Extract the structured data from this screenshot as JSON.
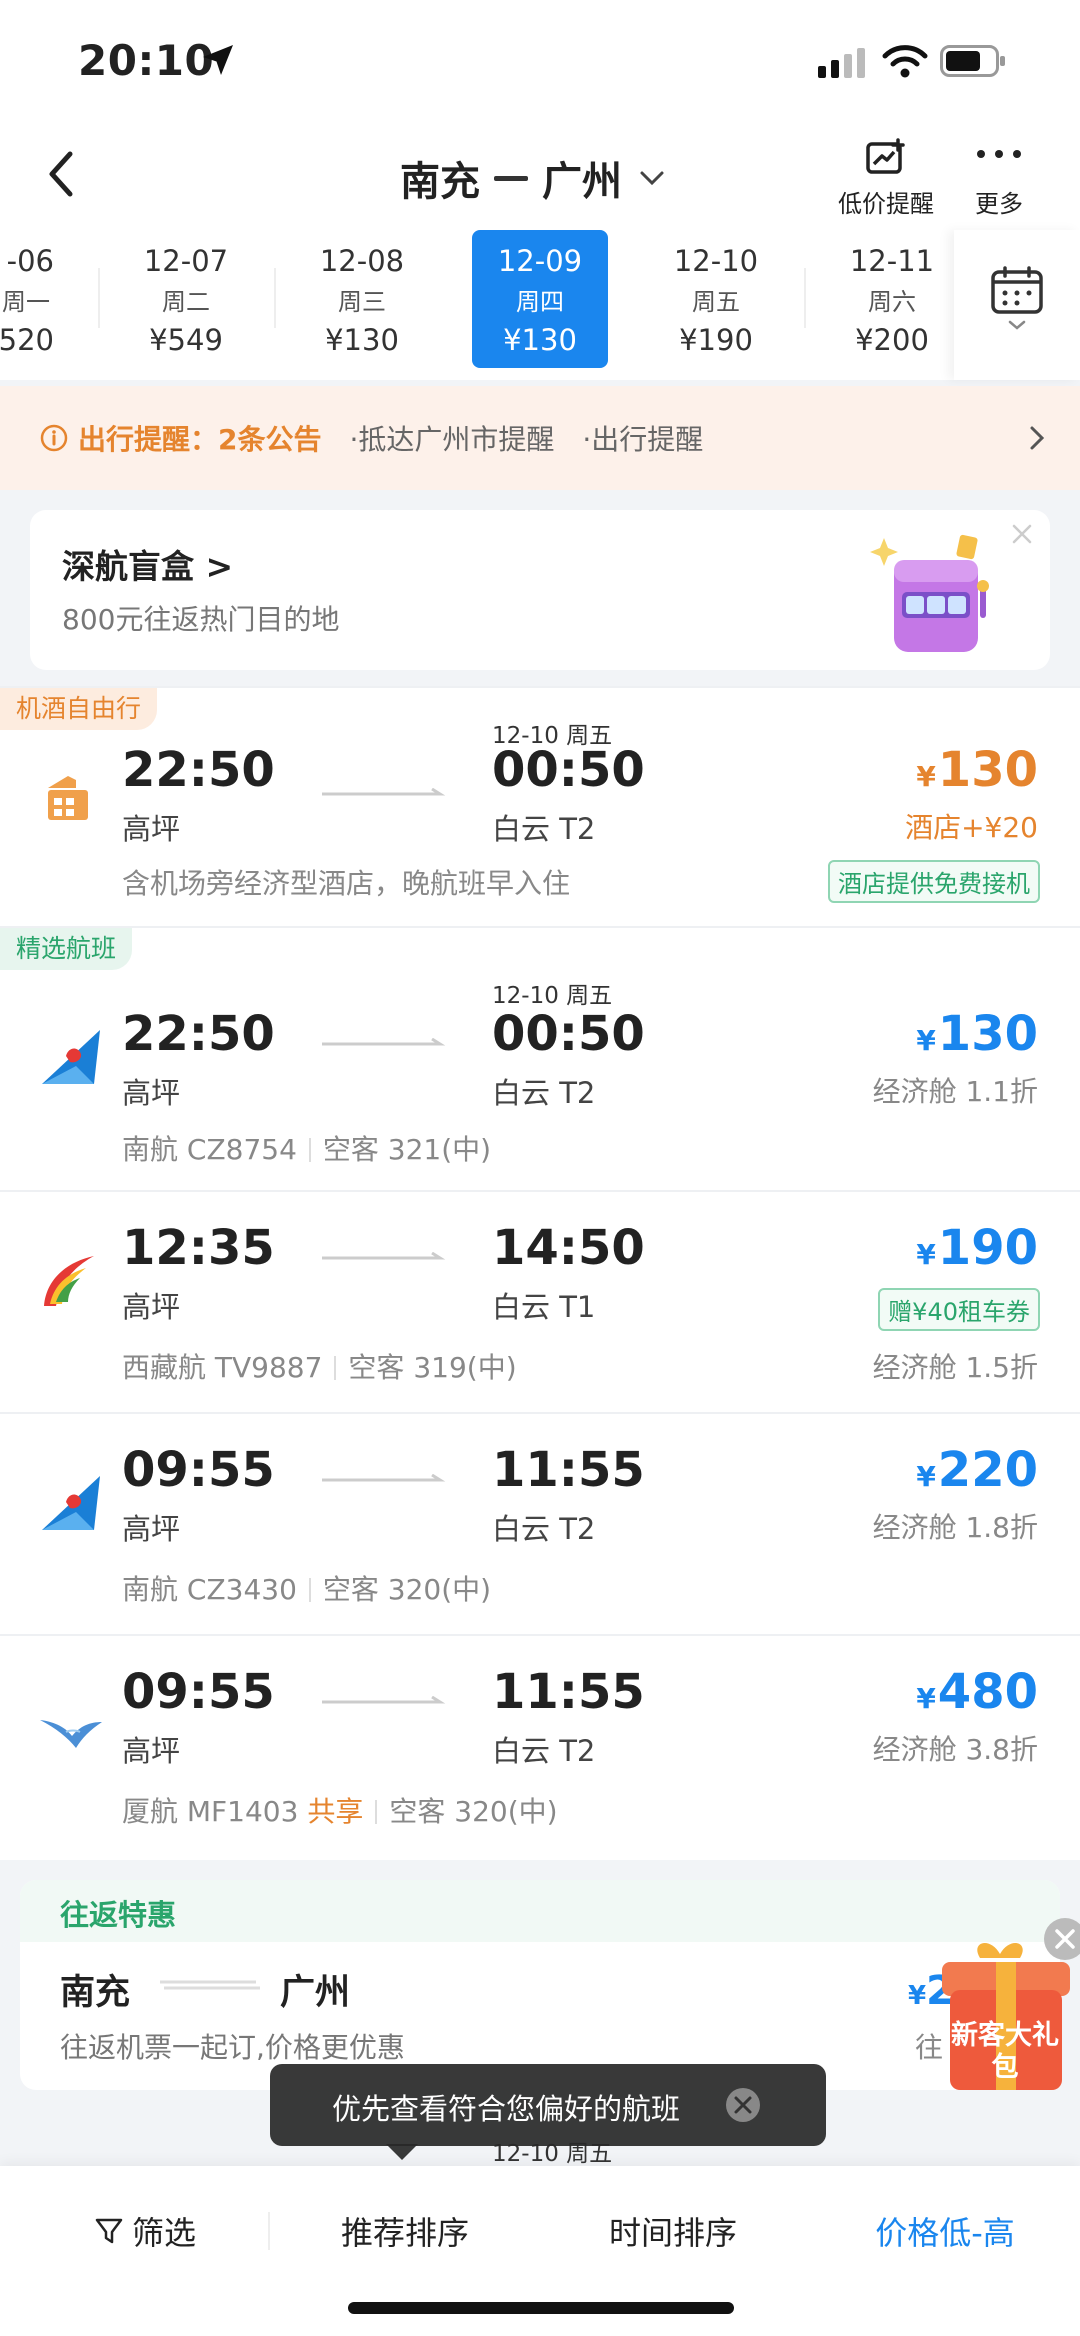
{
  "status_bar": {
    "time": "20:10"
  },
  "header": {
    "origin": "南充",
    "destination": "广州",
    "price_alert_label": "低价提醒",
    "more_label": "更多"
  },
  "dates": [
    {
      "date": "-06",
      "weekday": "周一",
      "price": "520",
      "active": false
    },
    {
      "date": "12-07",
      "weekday": "周二",
      "price": "¥549",
      "active": false
    },
    {
      "date": "12-08",
      "weekday": "周三",
      "price": "¥130",
      "active": false
    },
    {
      "date": "12-09",
      "weekday": "周四",
      "price": "¥130",
      "active": true
    },
    {
      "date": "12-10",
      "weekday": "周五",
      "price": "¥190",
      "active": false
    },
    {
      "date": "12-11",
      "weekday": "周六",
      "price": "¥200",
      "active": false
    }
  ],
  "notice": {
    "label": "出行提醒：",
    "count": "2条公告",
    "items": [
      "·抵达广州市提醒",
      "·出行提醒"
    ]
  },
  "promo": {
    "title": "深航盲盒 >",
    "subtitle": "800元往返热门目的地"
  },
  "flights": [
    {
      "tag": "机酒自由行",
      "dep_time": "22:50",
      "dep_airport": "高坪",
      "arr_date": "12-10 周五",
      "arr_time": "00:50",
      "arr_airport": "白云 T2",
      "price": "130",
      "sub": "酒店+¥20",
      "meta": "含机场旁经济型酒店，晚航班早入住",
      "badge": "酒店提供免费接机"
    },
    {
      "tag": "精选航班",
      "dep_time": "22:50",
      "dep_airport": "高坪",
      "arr_date": "12-10 周五",
      "arr_time": "00:50",
      "arr_airport": "白云 T2",
      "price": "130",
      "sub": "经济舱 1.1折",
      "airline": "南航 CZ8754",
      "aircraft": "空客 321(中)"
    },
    {
      "dep_time": "12:35",
      "dep_airport": "高坪",
      "arr_time": "14:50",
      "arr_airport": "白云 T1",
      "price": "190",
      "badge": "赠¥40租车券",
      "sub": "经济舱 1.5折",
      "airline": "西藏航 TV9887",
      "aircraft": "空客 319(中)"
    },
    {
      "dep_time": "09:55",
      "dep_airport": "高坪",
      "arr_time": "11:55",
      "arr_airport": "白云 T2",
      "price": "220",
      "sub": "经济舱 1.8折",
      "airline": "南航 CZ3430",
      "aircraft": "空客 320(中)"
    },
    {
      "dep_time": "09:55",
      "dep_airport": "高坪",
      "arr_time": "11:55",
      "arr_airport": "白云 T2",
      "price": "480",
      "sub": "经济舱 3.8折",
      "airline": "厦航 MF1403",
      "share": "共享",
      "aircraft": "空客 320(中)"
    }
  ],
  "round_trip": {
    "label": "往返特惠",
    "from": "南充",
    "to": "广州",
    "subtitle": "往返机票一起订,价格更优惠",
    "price": "26",
    "sub": "往"
  },
  "gift": {
    "label": "新客大礼包"
  },
  "next_card_date": "12-10 周五",
  "toast": {
    "text": "优先查看符合您偏好的航班"
  },
  "bottom_bar": {
    "filter": "筛选",
    "recommended": "推荐排序",
    "time_sort": "时间排序",
    "price_sort": "价格低-高"
  },
  "colors": {
    "accent_blue": "#1a86ee",
    "accent_orange": "#e5842e",
    "accent_green": "#2aa56c"
  }
}
